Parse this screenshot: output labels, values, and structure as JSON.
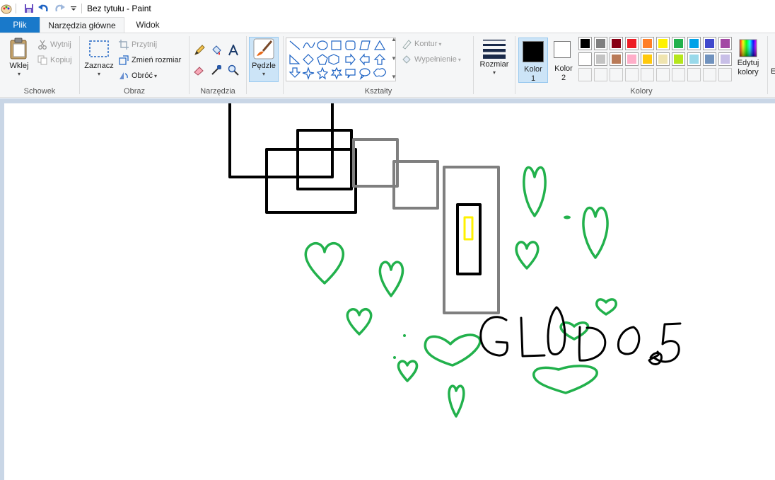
{
  "window": {
    "title": "Bez tytułu - Paint"
  },
  "quick_access": [
    "paint-app-icon",
    "save-icon",
    "undo-icon",
    "redo-icon",
    "customize-dropdown-icon"
  ],
  "tabs": {
    "file": "Plik",
    "home": "Narzędzia główne",
    "view": "Widok"
  },
  "ribbon": {
    "clipboard": {
      "label": "Schowek",
      "paste": "Wklej",
      "cut": "Wytnij",
      "copy": "Kopiuj"
    },
    "image": {
      "label": "Obraz",
      "select": "Zaznacz",
      "crop": "Przytnij",
      "resize": "Zmień rozmiar",
      "rotate": "Obróć"
    },
    "tools": {
      "label": "Narzędzia"
    },
    "brushes": {
      "label": "Pędzle"
    },
    "shapes": {
      "label": "Kształty",
      "outline": "Kontur",
      "fill": "Wypełnienie"
    },
    "size": {
      "label": "Rozmiar"
    },
    "colors": {
      "label": "Kolory",
      "color1": "Kolor",
      "color1_num": "1",
      "color2": "Kolor",
      "color2_num": "2",
      "edit": "Edytuj",
      "edit2": "kolory",
      "color1_value": "#000000",
      "color2_value": "#ffffff",
      "palette_row1": [
        "#000000",
        "#7f7f7f",
        "#880015",
        "#ed1c24",
        "#ff7f27",
        "#fff200",
        "#22b14c",
        "#00a2e8",
        "#3f48cc",
        "#a349a4"
      ],
      "palette_row2": [
        "#ffffff",
        "#c3c3c3",
        "#b97a57",
        "#ffaec9",
        "#ffc90e",
        "#efe4b0",
        "#b5e61d",
        "#99d9ea",
        "#7092be",
        "#c8bfe7"
      ],
      "palette_row3": [
        "#ffffff",
        "#ffffff",
        "#ffffff",
        "#ffffff",
        "#ffffff",
        "#ffffff",
        "#ffffff",
        "#ffffff",
        "#ffffff",
        "#ffffff"
      ]
    }
  },
  "canvas_colors": {
    "black": "#000000",
    "gray": "#7f7f7f",
    "green": "#22b14c",
    "yellow": "#fff200"
  }
}
